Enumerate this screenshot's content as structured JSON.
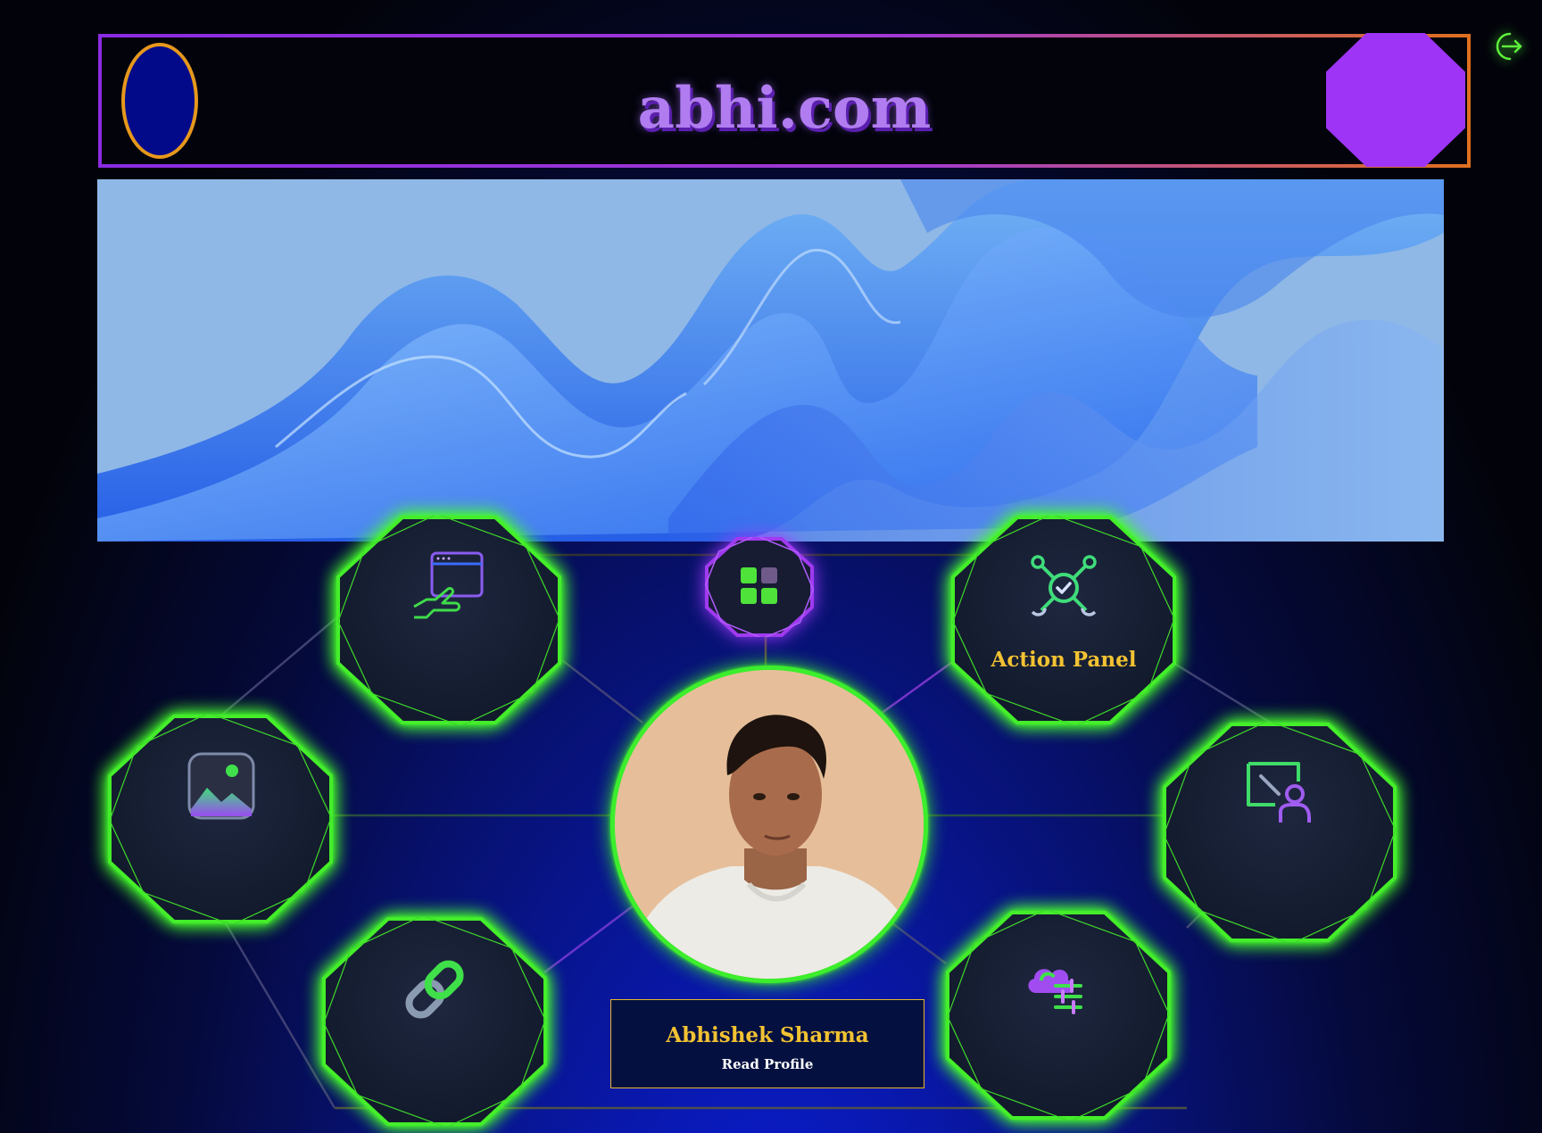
{
  "header": {
    "site_title": "abhi.com"
  },
  "nav_nodes": {
    "action_panel_label": "Action Panel"
  },
  "profile": {
    "name": "Abhishek Sharma",
    "link_label": "Read Profile"
  },
  "colors": {
    "neon_green": "#44ee2a",
    "purple": "#9e34f5",
    "gold": "#f2c232",
    "orange_border": "#e6981c"
  },
  "icons": {
    "top_right": "logout-icon",
    "node_web_hand": "web-hand-icon",
    "node_network": "network-check-icon",
    "node_image": "image-gallery-icon",
    "node_presentation": "presentation-icon",
    "node_link": "link-icon",
    "node_cloud_settings": "cloud-settings-icon",
    "hub": "grid-icon"
  }
}
